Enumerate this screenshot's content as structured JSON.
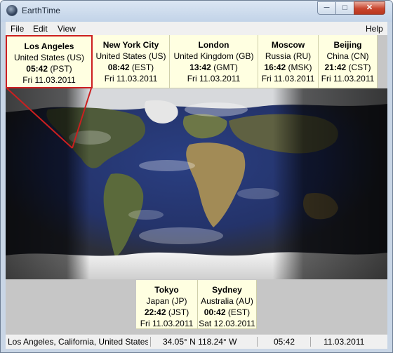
{
  "window": {
    "title": "EarthTime",
    "minimize": "─",
    "maximize": "□",
    "close": "✕"
  },
  "menu": {
    "file": "File",
    "edit": "Edit",
    "view": "View",
    "help": "Help"
  },
  "top_cities": [
    {
      "city": "Los Angeles",
      "country": "United States (US)",
      "time": "05:42",
      "zone": "(PST)",
      "date": "Fri 11.03.2011"
    },
    {
      "city": "New York City",
      "country": "United States (US)",
      "time": "08:42",
      "zone": "(EST)",
      "date": "Fri 11.03.2011"
    },
    {
      "city": "London",
      "country": "United Kingdom (GB)",
      "time": "13:42",
      "zone": "(GMT)",
      "date": "Fri 11.03.2011"
    },
    {
      "city": "Moscow",
      "country": "Russia (RU)",
      "time": "16:42",
      "zone": "(MSK)",
      "date": "Fri 11.03.2011"
    },
    {
      "city": "Beijing",
      "country": "China (CN)",
      "time": "21:42",
      "zone": "(CST)",
      "date": "Fri 11.03.2011"
    }
  ],
  "bottom_cities": [
    {
      "city": "Tokyo",
      "country": "Japan (JP)",
      "time": "22:42",
      "zone": "(JST)",
      "date": "Fri 11.03.2011"
    },
    {
      "city": "Sydney",
      "country": "Australia (AU)",
      "time": "00:42",
      "zone": "(EST)",
      "date": "Sat 12.03.2011"
    }
  ],
  "status": {
    "location": "Los Angeles, California, United States (",
    "coords": "34.05° N  118.24° W",
    "time": "05:42",
    "date": "11.03.2011"
  },
  "colors": {
    "card_bg": "#ffffe1",
    "selection": "#cc1f1f",
    "client_bg": "#c6c6c6"
  }
}
